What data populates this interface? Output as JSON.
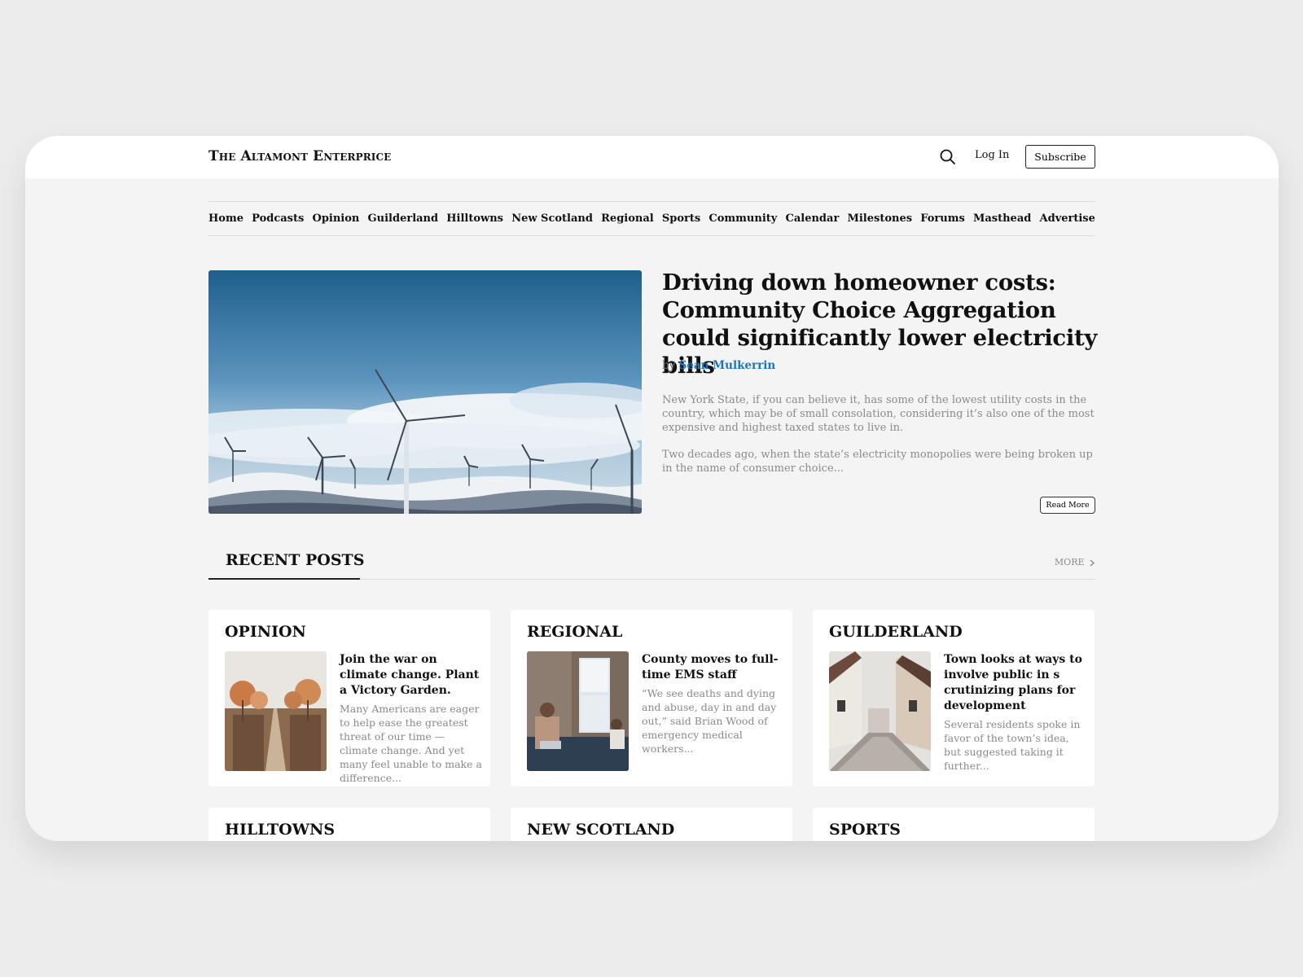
{
  "header": {
    "brand": "The Altamont Enterprice",
    "login_label": "Log In",
    "subscribe_label": "Subscribe"
  },
  "nav": {
    "items": [
      "Home",
      "Podcasts",
      "Opinion",
      "Guilderland",
      "Hilltowns",
      "New Scotland",
      "Regional",
      "Sports",
      "Community",
      "Calendar",
      "Milestones",
      "Forums",
      "Masthead",
      "Advertise"
    ]
  },
  "featured": {
    "title": "Driving down homeowner costs: Community Choice Aggregation could significantly lower electricity bills",
    "by": "by",
    "author": "Sean Mulkerrin",
    "excerpt1": "New York State, if you can believe it, has some of the lowest utility costs in the country, which may be of small consolation, considering it’s also one of the most expensive and highest taxed states to live in.",
    "excerpt2": "Two decades ago, when the state’s electricity monopolies were being broken up in the name of consumer choice...",
    "read_more_label": "Read More"
  },
  "recent": {
    "heading": "RECENT POSTS",
    "more_label": "MORE",
    "cards": [
      {
        "category": "OPINION",
        "title": "Join the war on climate change. Plant a Victory Garden.",
        "excerpt": "Many Americans are eager to help ease the greatest threat of our time — climate change. And yet many feel unable to make a difference..."
      },
      {
        "category": "REGIONAL",
        "title": "County moves to full-time EMS staff",
        "excerpt": "“We see deaths and dying and abuse, day in and day out,” said Brian Wood of emergency medical workers..."
      },
      {
        "category": "GUILDERLAND",
        "title": "Town looks at ways to involve public in s crutinizing plans for development",
        "excerpt": "Several residents spoke in favor of the town’s idea, but suggested taking it further..."
      },
      {
        "category": "HILLTOWNS"
      },
      {
        "category": "NEW SCOTLAND"
      },
      {
        "category": "SPORTS"
      }
    ]
  },
  "colors": {
    "page_bg": "#ececec",
    "frame_bg": "#f4f4f4",
    "accent_link": "#1f74b8",
    "muted_text": "#8a8a8a"
  },
  "icons": {
    "search": "search-icon",
    "more": "chevron-right-icon"
  }
}
